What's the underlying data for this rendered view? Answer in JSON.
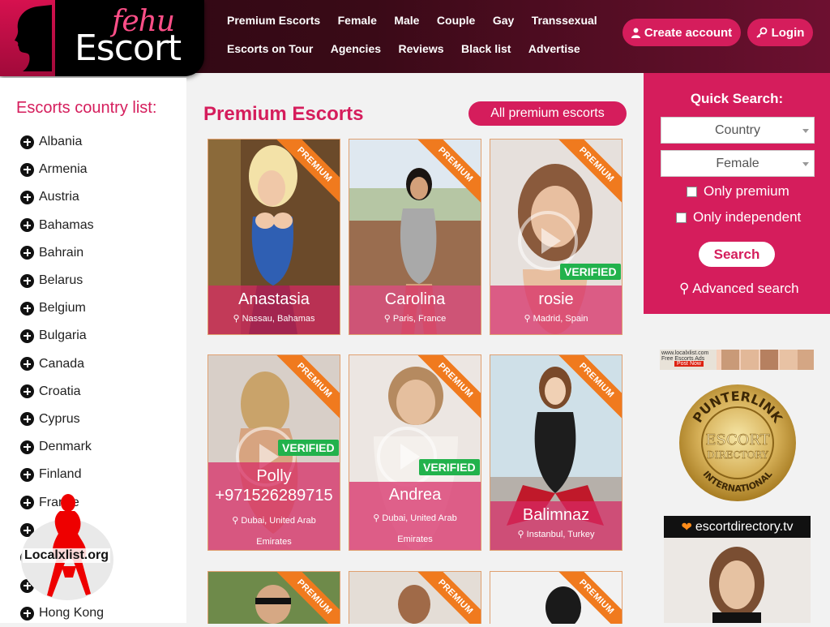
{
  "brand": {
    "fehu": "fehu",
    "escort": "Escort"
  },
  "nav": {
    "row1": [
      "Premium Escorts",
      "Female",
      "Male",
      "Couple",
      "Gay",
      "Transsexual"
    ],
    "row2": [
      "Escorts on Tour",
      "Agencies",
      "Reviews",
      "Black list",
      "Advertise"
    ]
  },
  "account": {
    "create": "Create account",
    "login": "Login"
  },
  "sidebar": {
    "title": "Escorts country list:",
    "countries": [
      "Albania",
      "Armenia",
      "Austria",
      "Bahamas",
      "Bahrain",
      "Belarus",
      "Belgium",
      "Bulgaria",
      "Canada",
      "Croatia",
      "Cyprus",
      "Denmark",
      "Finland",
      "France",
      "",
      "",
      "",
      "Hong Kong"
    ],
    "watermark": "Localxlist.org"
  },
  "main": {
    "title": "Premium Escorts",
    "all_button": "All premium escorts",
    "ribbon": "PREMIUM",
    "verified": "VERIFIED",
    "cards": [
      {
        "name": "Anastasia",
        "location": "Nassau, Bahamas"
      },
      {
        "name": "Carolina",
        "location": "Paris, France"
      },
      {
        "name": "rosie",
        "location": "Madrid, Spain"
      },
      {
        "name": "Polly\n+971526289715",
        "location": "Dubai, United Arab Emirates"
      },
      {
        "name": "Andrea",
        "location": "Dubai, United Arab Emirates"
      },
      {
        "name": "Balimnaz",
        "location": "Instanbul, Turkey"
      }
    ]
  },
  "quick_search": {
    "title": "Quick Search:",
    "country_select": "Country",
    "gender_select": "Female",
    "only_premium": "Only premium",
    "only_independent": "Only independent",
    "search_button": "Search",
    "advanced": "Advanced search"
  },
  "ads": {
    "localxlist_site": "www.localxlist.com",
    "localxlist_tagline": "Free Escorts Ads",
    "localxlist_post": "Post Now",
    "seal_top": "PUNTERLINK",
    "seal_mid1": "ESCORT",
    "seal_mid2": "DIRECTORY",
    "seal_bottom": "INTERNATIONAL",
    "escortdirectory": "escortdirectory.tv"
  },
  "colors": {
    "accent": "#d51d5c",
    "ribbon": "#f07a1e",
    "verified": "#22b24c"
  }
}
